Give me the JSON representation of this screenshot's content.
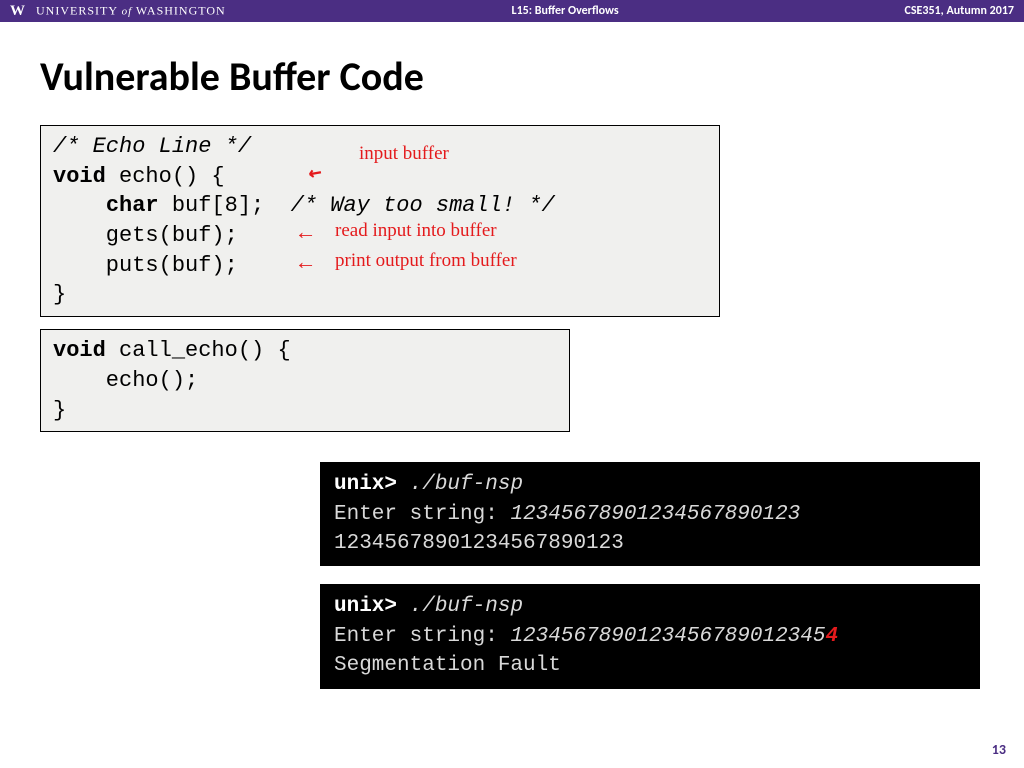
{
  "header": {
    "uw_prefix": "UNIVERSITY",
    "uw_of": "of",
    "uw_suffix": "WASHINGTON",
    "center": "L15:  Buffer Overflows",
    "right": "CSE351, Autumn 2017"
  },
  "title": "Vulnerable Buffer Code",
  "code1": {
    "l1": "/* Echo Line */",
    "l2a": "void",
    "l2b": " echo() {",
    "l3a": "    ",
    "l3b": "char",
    "l3c": " buf[8];  ",
    "l3d": "/* Way too small! */",
    "l4": "    gets(buf);",
    "l5": "    puts(buf);",
    "l6": "}"
  },
  "code2": {
    "l1a": "void",
    "l1b": " call_echo() {",
    "l2": "    echo();",
    "l3": "}"
  },
  "annotations": {
    "a1": "input buffer",
    "a2": "read input into buffer",
    "a3": "print output from buffer"
  },
  "term1": {
    "prompt": "unix>",
    "cmd": "./buf-nsp",
    "lineA_pre": "Enter string: ",
    "lineA_in": "12345678901234567890123",
    "lineB": "12345678901234567890123"
  },
  "term2": {
    "prompt": "unix>",
    "cmd": "./buf-nsp",
    "lineA_pre": "Enter string: ",
    "lineA_in": "1234567890123456789012345",
    "lineA_red": "4",
    "lineB": "Segmentation Fault"
  },
  "page": "13"
}
